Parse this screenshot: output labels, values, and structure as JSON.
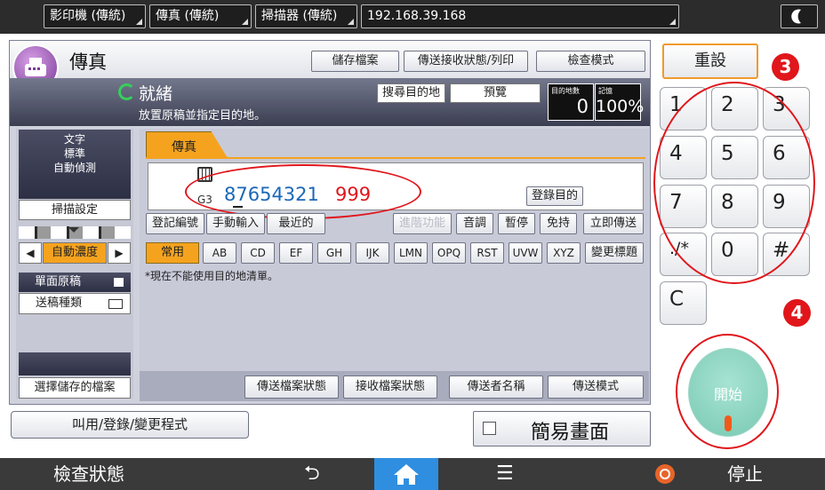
{
  "topbar": {
    "tabs": [
      "影印機 (傳統)",
      "傳真 (傳統)",
      "掃描器 (傳統)",
      "192.168.39.168"
    ],
    "moon_icon": "moon-icon"
  },
  "header": {
    "title": "傳真",
    "buttons": [
      "儲存檔案",
      "傳送接收狀態/列印",
      "檢查模式"
    ]
  },
  "status": {
    "ready": "就緒",
    "hint": "放置原稿並指定目的地。",
    "search_dest": "搜尋目的地",
    "preview": "預覽",
    "dest_count_label": "目的地數",
    "dest_count": "0",
    "memory_label": "記憶",
    "memory": "100%"
  },
  "left_panel": {
    "mode_lines": [
      "文字",
      "標準",
      "自動偵測"
    ],
    "scan_settings": "掃描設定",
    "auto_density": "自動濃度",
    "left_arrow": "◀",
    "right_arrow": "▶",
    "original_type": "單面原稿",
    "original_feed": "送稿種類",
    "select_stored": "選擇儲存的檔案"
  },
  "fax": {
    "tab": "傳真",
    "line_type": "G3",
    "number": "87654321",
    "extension": "999",
    "register_dest": "登錄目的",
    "row_buttons": [
      "登記編號",
      "手動輸入",
      "最近的",
      "進階功能",
      "音調",
      "暫停",
      "免持",
      "立即傳送"
    ],
    "index_tabs": [
      "常用",
      "AB",
      "CD",
      "EF",
      "GH",
      "IJK",
      "LMN",
      "OPQ",
      "RST",
      "UVW",
      "XYZ",
      "變更標題"
    ],
    "notice": "*現在不能使用目的地清單。",
    "bottom_buttons": [
      "傳送檔案狀態",
      "接收檔案狀態",
      "傳送者名稱",
      "傳送模式"
    ]
  },
  "program_button": "叫用/登錄/變更程式",
  "simple_screen": "簡易畫面",
  "keypad": {
    "reset": "重設",
    "keys": [
      "1",
      "2",
      "3",
      "4",
      "5",
      "6",
      "7",
      "8",
      "9",
      "./*",
      "0",
      "#"
    ],
    "clear": "C",
    "marker_3": "3",
    "marker_4": "4",
    "start": "開始"
  },
  "bottombar": {
    "check_status": "檢查狀態",
    "stop": "停止",
    "back_symbol": "⮌",
    "menu_symbol": "☰"
  },
  "colors": {
    "annotation_red": "#e0161b",
    "start_green": "#8fd8c4",
    "home_blue": "#2f8ee0",
    "accent_orange": "#f09a2a"
  }
}
